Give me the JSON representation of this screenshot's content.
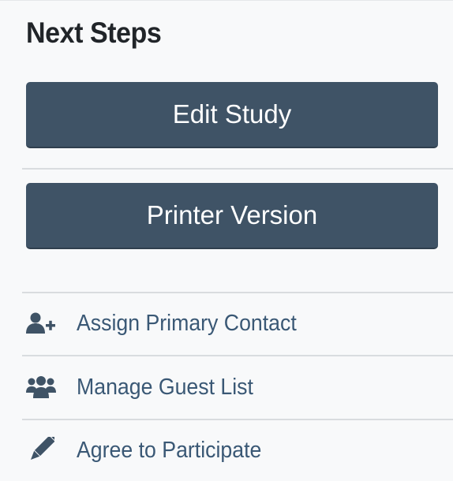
{
  "panel": {
    "title": "Next Steps"
  },
  "buttons": {
    "edit_label": "Edit Study",
    "print_label": "Printer Version"
  },
  "links": [
    {
      "label": "Assign Primary Contact",
      "icon": "user-plus-icon"
    },
    {
      "label": "Manage Guest List",
      "icon": "users-icon"
    },
    {
      "label": "Agree to Participate",
      "icon": "pencil-icon"
    }
  ],
  "colors": {
    "button_bg": "#3f5366",
    "link_text": "#3a5875",
    "icon": "#3f5366",
    "background": "#f8f9fa"
  }
}
